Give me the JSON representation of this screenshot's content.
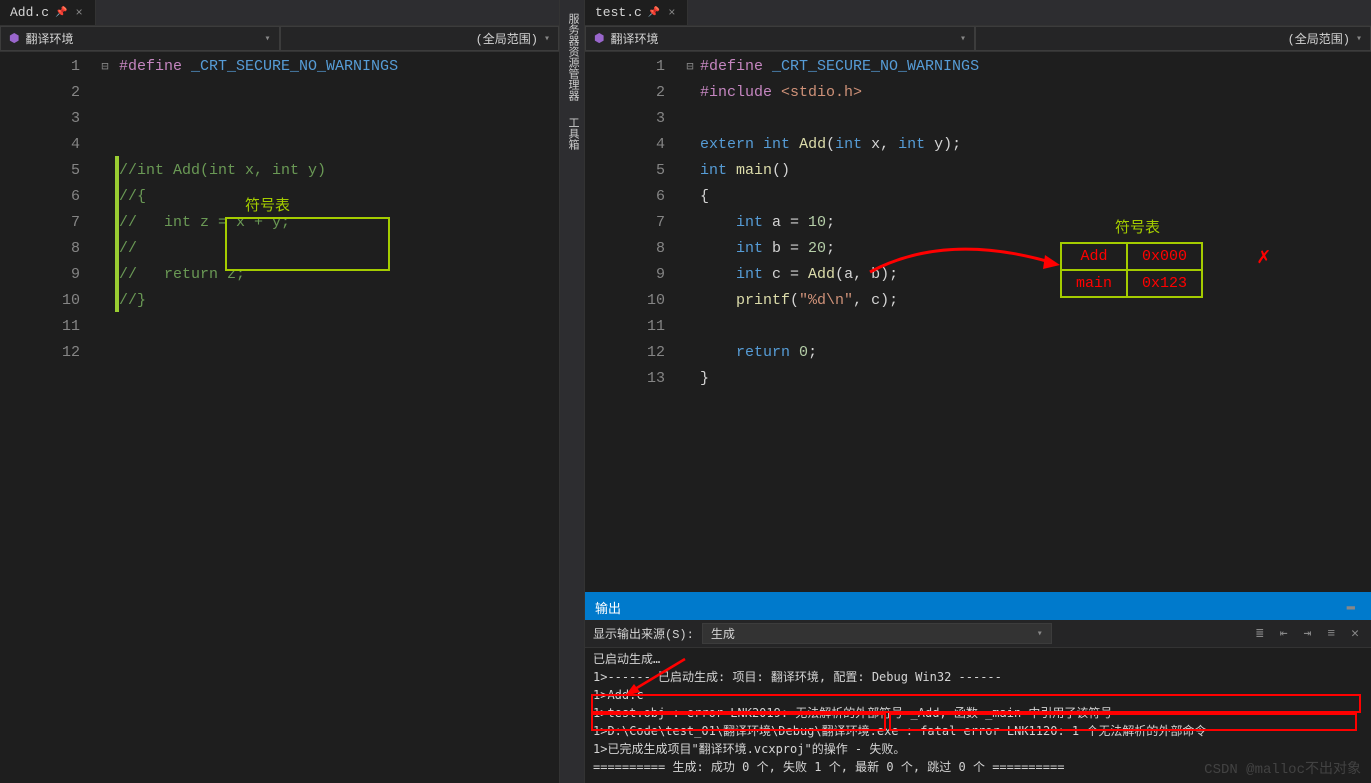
{
  "left": {
    "tab": {
      "filename": "Add.c"
    },
    "context": {
      "scope": "翻译环境",
      "right": "(全局范围)"
    },
    "code": {
      "lines": [
        {
          "n": 1,
          "html": "<span class='preproc'>#define</span> <span class='macro'>_CRT_SECURE_NO_WARNINGS</span>"
        },
        {
          "n": 2,
          "html": ""
        },
        {
          "n": 3,
          "html": ""
        },
        {
          "n": 4,
          "html": ""
        },
        {
          "n": 5,
          "html": "<span class='comment'>//int Add(int x, int y)</span>",
          "fold": "⊟",
          "changed": true
        },
        {
          "n": 6,
          "html": "<span class='comment'>//{</span>",
          "changed": true
        },
        {
          "n": 7,
          "html": "<span class='comment'>//   int z = x + y;</span>",
          "changed": true
        },
        {
          "n": 8,
          "html": "<span class='comment'>//</span>",
          "changed": true
        },
        {
          "n": 9,
          "html": "<span class='comment'>//   return z;</span>",
          "changed": true
        },
        {
          "n": 10,
          "html": "<span class='comment'>//}</span>",
          "changed": true
        },
        {
          "n": 11,
          "html": ""
        },
        {
          "n": 12,
          "html": ""
        }
      ]
    },
    "annotation": {
      "label": "符号表"
    }
  },
  "sidebar": {
    "items": [
      "服务器资源管理器",
      "工具箱"
    ]
  },
  "right": {
    "tab": {
      "filename": "test.c"
    },
    "context": {
      "scope": "翻译环境",
      "right": "(全局范围)"
    },
    "code": {
      "lines": [
        {
          "n": 1,
          "html": "<span class='preproc'>#define</span> <span class='macro'>_CRT_SECURE_NO_WARNINGS</span>"
        },
        {
          "n": 2,
          "html": "<span class='preproc'>#include</span> <span class='angle'>&lt;stdio.h&gt;</span>"
        },
        {
          "n": 3,
          "html": ""
        },
        {
          "n": 4,
          "html": "<span class='kw'>extern</span> <span class='type'>int</span> <span class='func'>Add</span>(<span class='type'>int</span> x, <span class='type'>int</span> y);"
        },
        {
          "n": 5,
          "html": "<span class='type'>int</span> <span class='func'>main</span>()",
          "fold": "⊟"
        },
        {
          "n": 6,
          "html": "{"
        },
        {
          "n": 7,
          "html": "    <span class='type'>int</span> a = <span class='num'>10</span>;"
        },
        {
          "n": 8,
          "html": "    <span class='type'>int</span> b = <span class='num'>20</span>;"
        },
        {
          "n": 9,
          "html": "    <span class='type'>int</span> c = <span class='func'>Add</span>(a, b);"
        },
        {
          "n": 10,
          "html": "    <span class='func'>printf</span>(<span class='str'>\"%d\\n\"</span>, c);"
        },
        {
          "n": 11,
          "html": ""
        },
        {
          "n": 12,
          "html": "    <span class='kw'>return</span> <span class='num'>0</span>;"
        },
        {
          "n": 13,
          "html": "}"
        }
      ]
    },
    "annotation": {
      "label": "符号表",
      "table": [
        [
          "Add",
          "0x000"
        ],
        [
          "main",
          "0x123"
        ]
      ]
    }
  },
  "output": {
    "title": "输出",
    "source_label": "显示输出来源(S):",
    "source_value": "生成",
    "lines": [
      "已启动生成…",
      "1>------ 已启动生成: 项目: 翻译环境, 配置: Debug Win32 ------",
      "1>Add.c",
      "1>test.obj : error LNK2019: 无法解析的外部符号 _Add, 函数 _main 中引用了该符号",
      "1>D:\\Code\\test_01\\翻译环境\\Debug\\翻译环境.exe : fatal error LNK1120: 1 个无法解析的外部命令",
      "1>已完成生成项目\"翻译环境.vcxproj\"的操作 - 失败。",
      "========== 生成: 成功 0 个, 失败 1 个, 最新 0 个, 跳过 0 个 =========="
    ]
  },
  "watermark": "CSDN @malloc不出对象"
}
